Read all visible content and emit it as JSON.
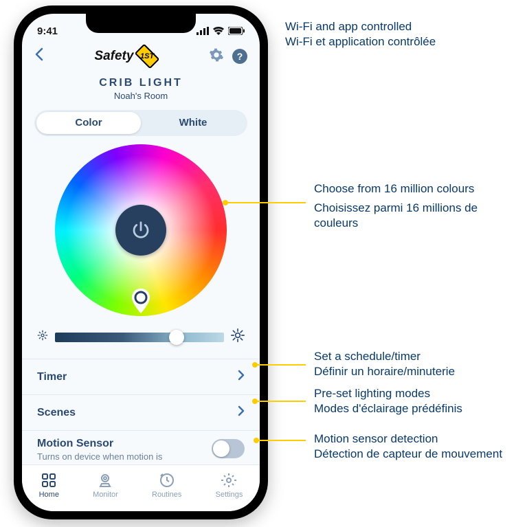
{
  "status": {
    "time": "9:41"
  },
  "brand": {
    "name": "Safety",
    "badge": "1ST"
  },
  "header": {
    "device_title": "CRIB LIGHT",
    "room": "Noah's Room"
  },
  "segmented": {
    "color": "Color",
    "white": "White",
    "active": "color"
  },
  "rows": {
    "timer": "Timer",
    "scenes": "Scenes",
    "motion_title": "Motion Sensor",
    "motion_sub": "Turns on device when motion is"
  },
  "tabs": {
    "home": "Home",
    "monitor": "Monitor",
    "routines": "Routines",
    "settings": "Settings"
  },
  "callouts": {
    "wifi_en": "Wi-Fi and app controlled",
    "wifi_fr": "Wi-Fi et application contrôlée",
    "colors_en": "Choose from 16 million colours",
    "colors_fr": "Choisissez parmi 16 millions de couleurs",
    "timer_en": "Set a schedule/timer",
    "timer_fr": "Définir un horaire/minuterie",
    "scenes_en": "Pre-set lighting modes",
    "scenes_fr": "Modes d'éclairage prédéfinis",
    "motion_en": "Motion sensor detection",
    "motion_fr": "Détection de capteur de mouvement"
  },
  "colors": {
    "accent": "#ffcc00",
    "brand_blue": "#2b4a73"
  }
}
